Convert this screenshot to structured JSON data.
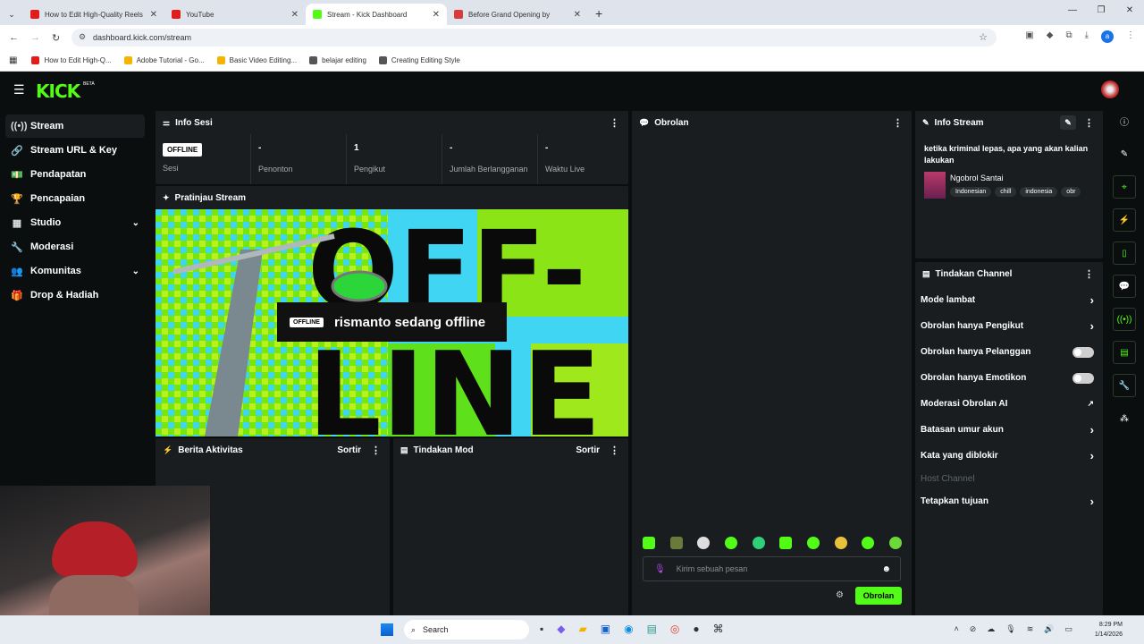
{
  "browser": {
    "tabs": [
      {
        "title": "How to Edit High-Quality Reels",
        "color": "#e21b1b",
        "active": false
      },
      {
        "title": "YouTube",
        "color": "#e21b1b",
        "active": false
      },
      {
        "title": "Stream - Kick Dashboard",
        "color": "#53fc18",
        "active": true
      },
      {
        "title": "Before Grand Opening by",
        "color": "#d93a3a",
        "active": false
      }
    ],
    "url": "dashboard.kick.com/stream",
    "bookmarks": [
      "How to Edit High-Q...",
      "Adobe Tutorial - Go...",
      "Basic Video Editing...",
      "belajar editing",
      "Creating Editing Style"
    ]
  },
  "app": {
    "logo": "KICK",
    "logo_beta": "BETA",
    "accent": "#53fc18",
    "sidebar": [
      {
        "label": "Stream",
        "icon": "radio-icon",
        "glyph": "((•))",
        "selected": true,
        "expand": false
      },
      {
        "label": "Stream URL & Key",
        "icon": "link-icon",
        "glyph": "🔗",
        "selected": false,
        "expand": false
      },
      {
        "label": "Pendapatan",
        "icon": "money-icon",
        "glyph": "💵",
        "selected": false,
        "expand": false
      },
      {
        "label": "Pencapaian",
        "icon": "trophy-icon",
        "glyph": "🏆",
        "selected": false,
        "expand": false
      },
      {
        "label": "Studio",
        "icon": "grid-icon",
        "glyph": "▦",
        "selected": false,
        "expand": true
      },
      {
        "label": "Moderasi",
        "icon": "wrench-icon",
        "glyph": "🔧",
        "selected": false,
        "expand": false
      },
      {
        "label": "Komunitas",
        "icon": "users-icon",
        "glyph": "👥",
        "selected": false,
        "expand": true
      },
      {
        "label": "Drop & Hadiah",
        "icon": "gift-icon",
        "glyph": "🎁",
        "selected": false,
        "expand": false
      }
    ],
    "info_sesi": {
      "title": "Info Sesi",
      "badge": "OFFLINE",
      "stats": [
        {
          "value": "",
          "label": "Sesi"
        },
        {
          "value": "-",
          "label": "Penonton"
        },
        {
          "value": "1",
          "label": "Pengikut"
        },
        {
          "value": "-",
          "label": "Jumlah Berlangganan"
        },
        {
          "value": "-",
          "label": "Waktu Live"
        }
      ]
    },
    "preview": {
      "title": "Pratinjau Stream",
      "badge": "OFFLINE",
      "message": "rismanto sedang offline",
      "bg_text_1": "OFF-",
      "bg_text_2": "LINE"
    },
    "activity": {
      "title": "Berita Aktivitas",
      "sort": "Sortir"
    },
    "mod_actions": {
      "title": "Tindakan Mod",
      "sort": "Sortir"
    },
    "chat": {
      "title": "Obrolan",
      "placeholder": "Kirim sebuah pesan",
      "send": "Obrolan"
    },
    "stream_info": {
      "title": "Info Stream",
      "stream_title": "ketika kriminal lepas, apa yang akan kalian lakukan",
      "category": "Ngobrol Santai",
      "tags": [
        "Indonesian",
        "chill",
        "indonesia",
        "obr"
      ]
    },
    "channel_actions": {
      "title": "Tindakan Channel",
      "items": [
        {
          "label": "Mode lambat",
          "control": "arrow"
        },
        {
          "label": "Obrolan hanya Pengikut",
          "control": "arrow"
        },
        {
          "label": "Obrolan hanya Pelanggan",
          "control": "toggle"
        },
        {
          "label": "Obrolan hanya Emotikon",
          "control": "toggle"
        },
        {
          "label": "Moderasi Obrolan AI",
          "control": "external"
        },
        {
          "label": "Batasan umur akun",
          "control": "arrow"
        },
        {
          "label": "Kata yang diblokir",
          "control": "arrow"
        },
        {
          "label": "Host Channel",
          "control": "disabled"
        },
        {
          "label": "Tetapkan tujuan",
          "control": "arrow"
        }
      ]
    }
  },
  "taskbar": {
    "search": "Search",
    "time": "8:29 PM",
    "date": "1/14/2026"
  }
}
